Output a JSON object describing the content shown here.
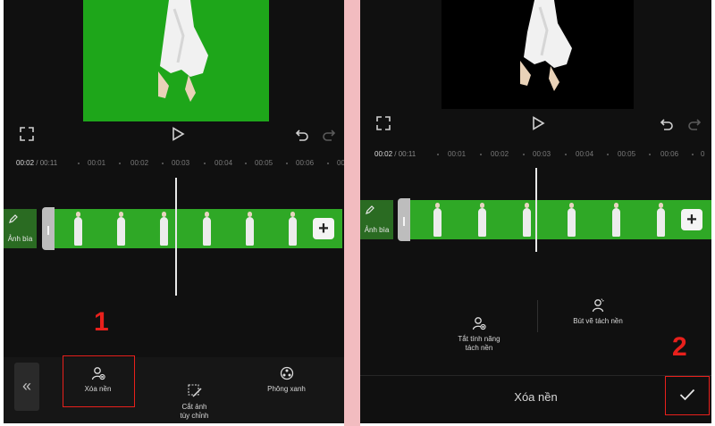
{
  "left": {
    "timecode_current": "00:02",
    "timecode_total": "/ 00:11",
    "ticks": [
      "00:01",
      "00:02",
      "00:03",
      "00:04",
      "00:05",
      "00:06",
      "00"
    ],
    "cover_label": "Ảnh bìa",
    "tools": [
      {
        "label": "Xóa nền",
        "icon": "remove-bg-icon"
      },
      {
        "label": "Cắt ảnh\ntùy chỉnh",
        "icon": "custom-cutout-icon"
      },
      {
        "label": "Phông xanh",
        "icon": "chroma-key-icon"
      }
    ],
    "annotation": "1",
    "collapse_glyph": "«",
    "plus": "+"
  },
  "right": {
    "timecode_current": "00:02",
    "timecode_total": "/ 00:11",
    "ticks": [
      "00:01",
      "00:02",
      "00:03",
      "00:04",
      "00:05",
      "00:06",
      "0"
    ],
    "cover_label": "Ảnh bìa",
    "options": [
      {
        "label": "Tắt tính năng\ntách nền",
        "icon": "disable-bg-removal-icon"
      },
      {
        "label": "Bút vẽ tách nền",
        "icon": "brush-bg-removal-icon"
      }
    ],
    "bottom_title": "Xóa nền",
    "annotation": "2",
    "plus": "+"
  },
  "colors": {
    "green_screen": "#1ea61a",
    "annotation_red": "#e8201c",
    "divider_pink": "#f2bcc0"
  }
}
